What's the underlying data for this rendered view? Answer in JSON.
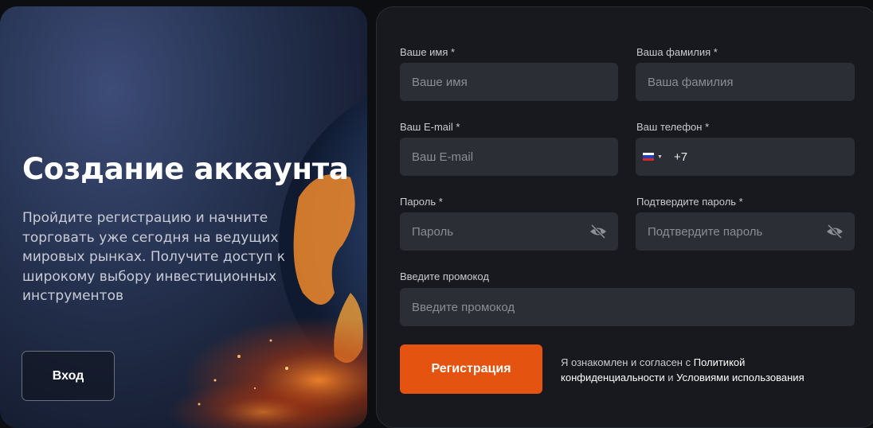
{
  "hero": {
    "title": "Создание аккаунта",
    "description": "Пройдите регистрацию и начните торговать уже сегодня на ведущих мировых рынках. Получите доступ к широкому выбору инвестиционных инструментов",
    "login_label": "Вход"
  },
  "form": {
    "first_name": {
      "label": "Ваше имя *",
      "placeholder": "Ваше имя"
    },
    "last_name": {
      "label": "Ваша фамилия *",
      "placeholder": "Ваша фамилия"
    },
    "email": {
      "label": "Ваш E-mail *",
      "placeholder": "Ваш E-mail"
    },
    "phone": {
      "label": "Ваш телефон *",
      "country_code": "+7",
      "flag": "ru-flag-icon"
    },
    "password": {
      "label": "Пароль *",
      "placeholder": "Пароль"
    },
    "password_confirm": {
      "label": "Подтвердите пароль *",
      "placeholder": "Подтвердите пароль"
    },
    "promo": {
      "label": "Введите промокод",
      "placeholder": "Введите промокод"
    },
    "submit_label": "Регистрация",
    "consent": {
      "prefix": "Я ознакомлен и согласен с ",
      "privacy_link": "Политикой конфиденциальности",
      "conjunction": " и ",
      "terms_link": "Условиями использования"
    }
  },
  "colors": {
    "accent": "#e4530f",
    "panel": "#17191e",
    "input_bg": "#2b2e34"
  }
}
